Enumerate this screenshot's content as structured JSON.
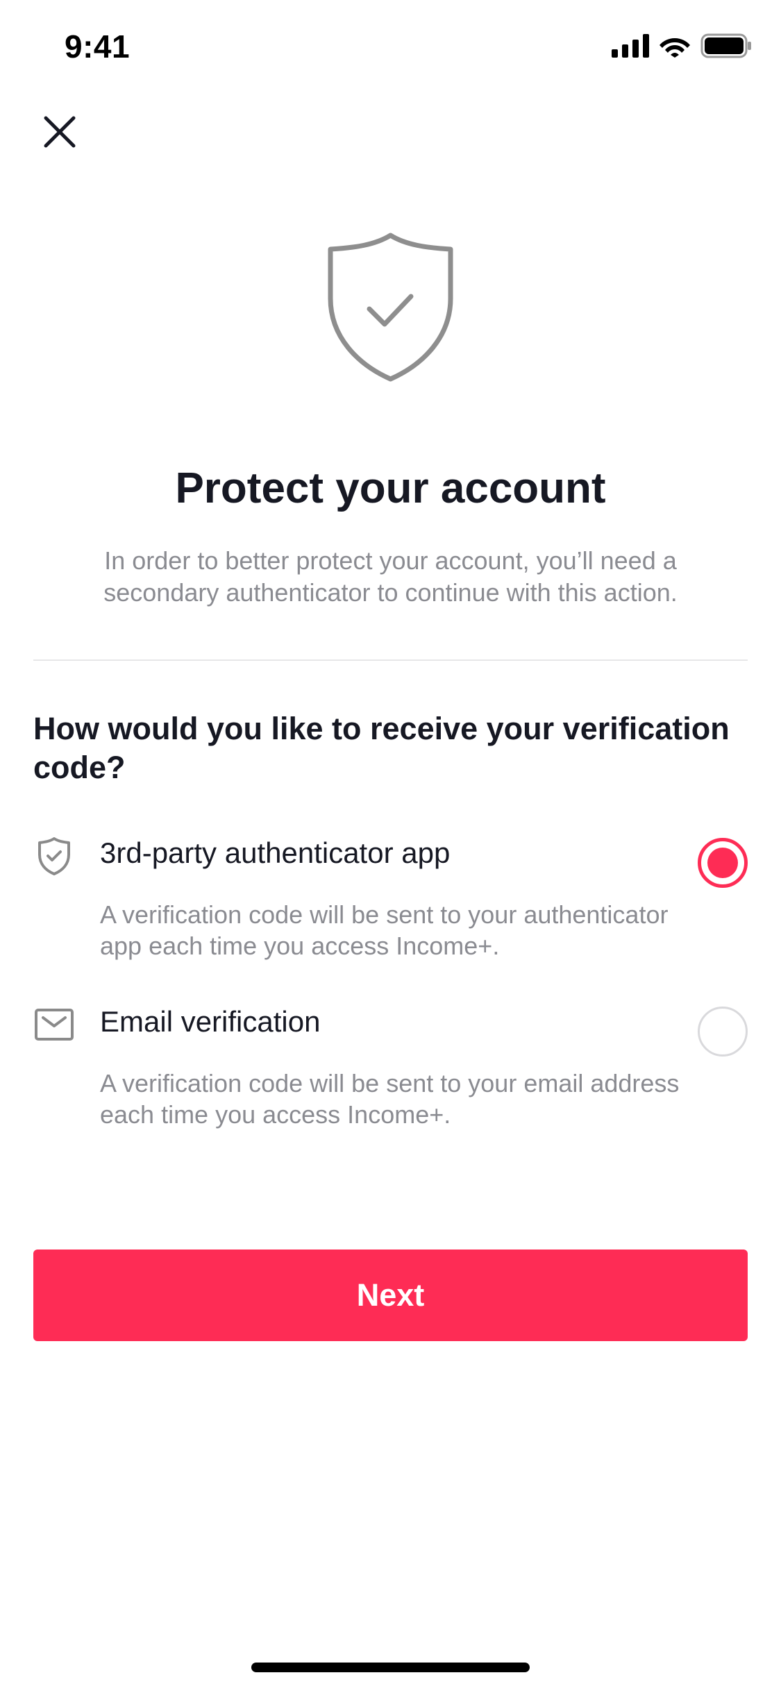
{
  "status_bar": {
    "time": "9:41",
    "icons": [
      "cellular-signal-icon",
      "wifi-icon",
      "battery-icon"
    ]
  },
  "header": {
    "close_icon": "close-icon"
  },
  "hero": {
    "icon": "shield-check-icon",
    "title": "Protect your account",
    "subtitle": "In order to better protect your account, you’ll need a secondary authenticator to continue with this action."
  },
  "question": "How would you like to receive your verification code?",
  "options": [
    {
      "icon": "shield-check-icon",
      "title": "3rd-party authenticator app",
      "description": "A verification code will be sent to your authenticator app each time you access Income+.",
      "selected": true
    },
    {
      "icon": "envelope-icon",
      "title": "Email verification",
      "description": "A verification code will be sent to your email address each time you access Income+.",
      "selected": false
    }
  ],
  "next_button": {
    "label": "Next"
  },
  "colors": {
    "accent": "#fe2c55",
    "text_primary": "#161823",
    "text_secondary": "#8a8b91",
    "icon_gray": "#8a8a8a"
  }
}
